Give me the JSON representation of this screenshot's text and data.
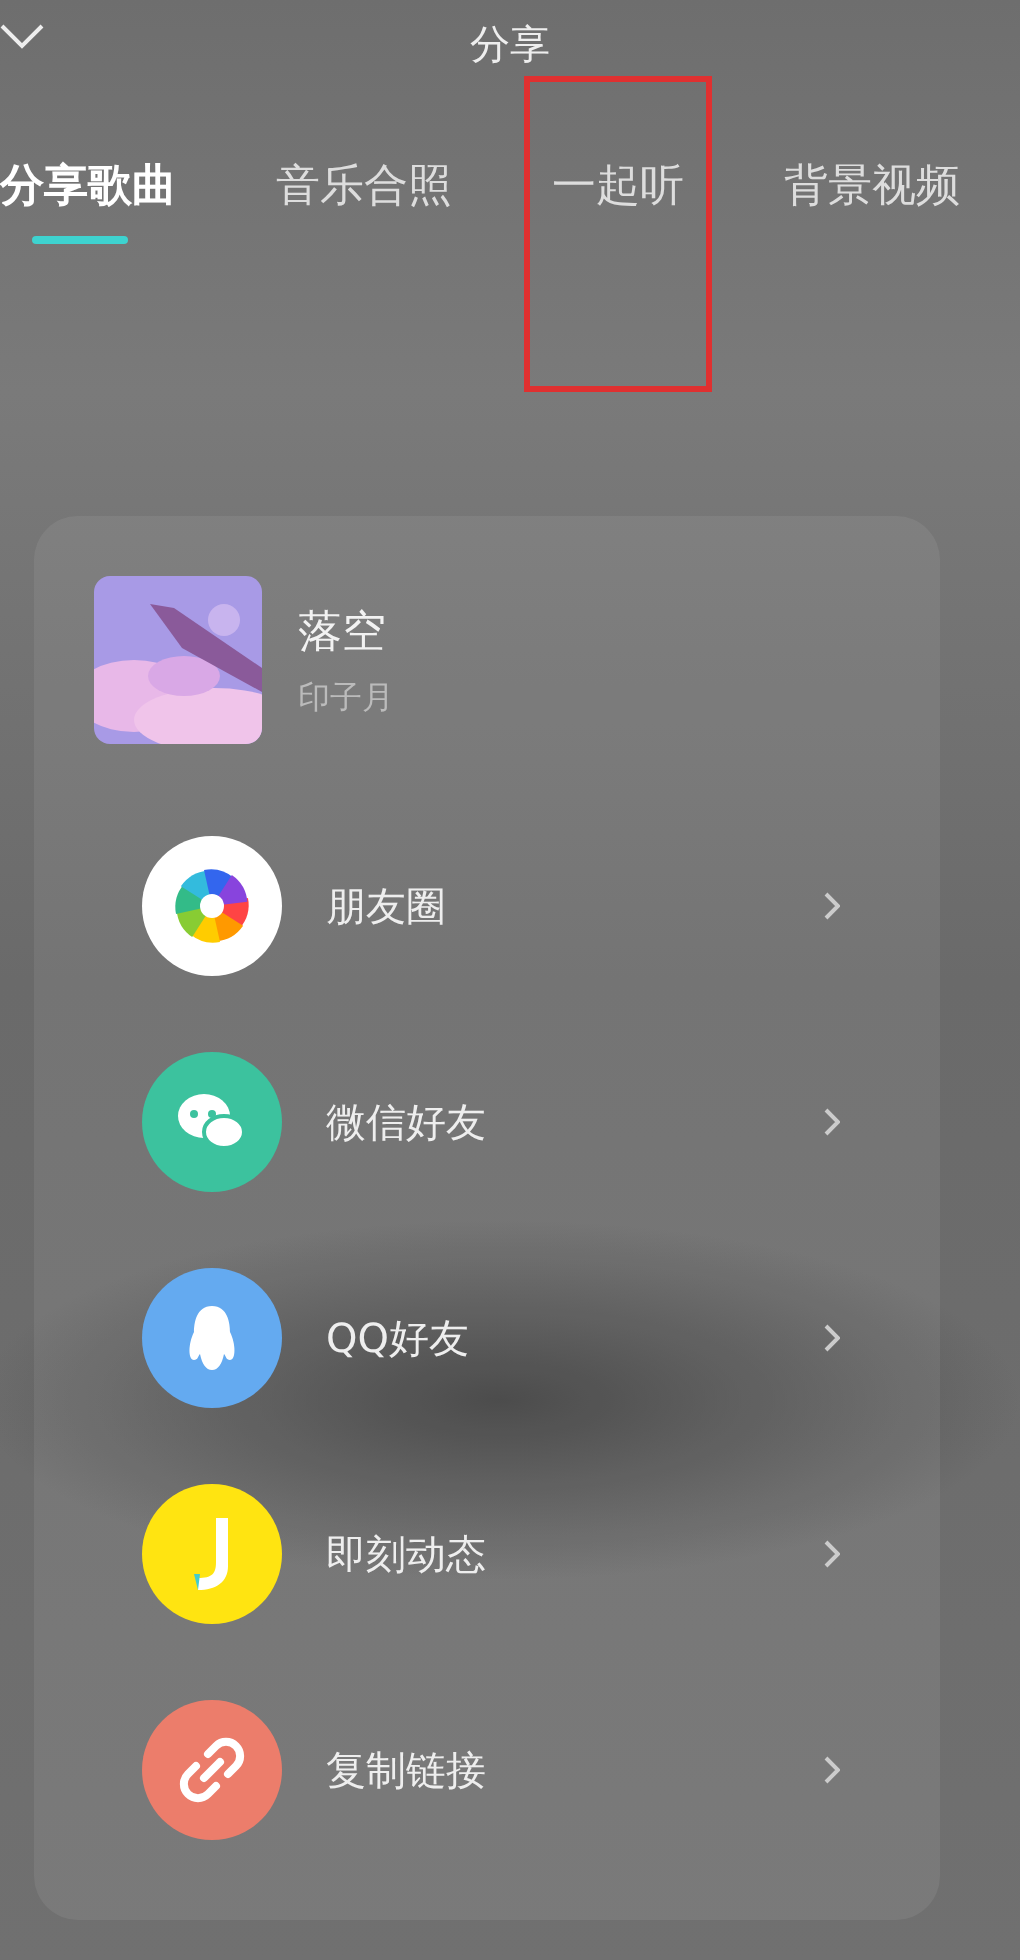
{
  "header": {
    "title": "分享"
  },
  "tabs": [
    {
      "label": "分享歌曲",
      "selected": true,
      "highlighted": false
    },
    {
      "label": "音乐合照",
      "selected": false,
      "highlighted": false
    },
    {
      "label": "一起听",
      "selected": false,
      "highlighted": true
    },
    {
      "label": "背景视频",
      "selected": false,
      "highlighted": false
    }
  ],
  "song": {
    "title": "落空",
    "artist": "印子月"
  },
  "share_targets": [
    {
      "kind": "moments",
      "label": "朋友圈",
      "color": "#ffffff"
    },
    {
      "kind": "wechat",
      "label": "微信好友",
      "color": "#3cc29e"
    },
    {
      "kind": "qq",
      "label": "QQ好友",
      "color": "#64aaf0"
    },
    {
      "kind": "jike",
      "label": "即刻动态",
      "color": "#ffe411"
    },
    {
      "kind": "link",
      "label": "复制链接",
      "color": "#ec7d6b"
    }
  ]
}
